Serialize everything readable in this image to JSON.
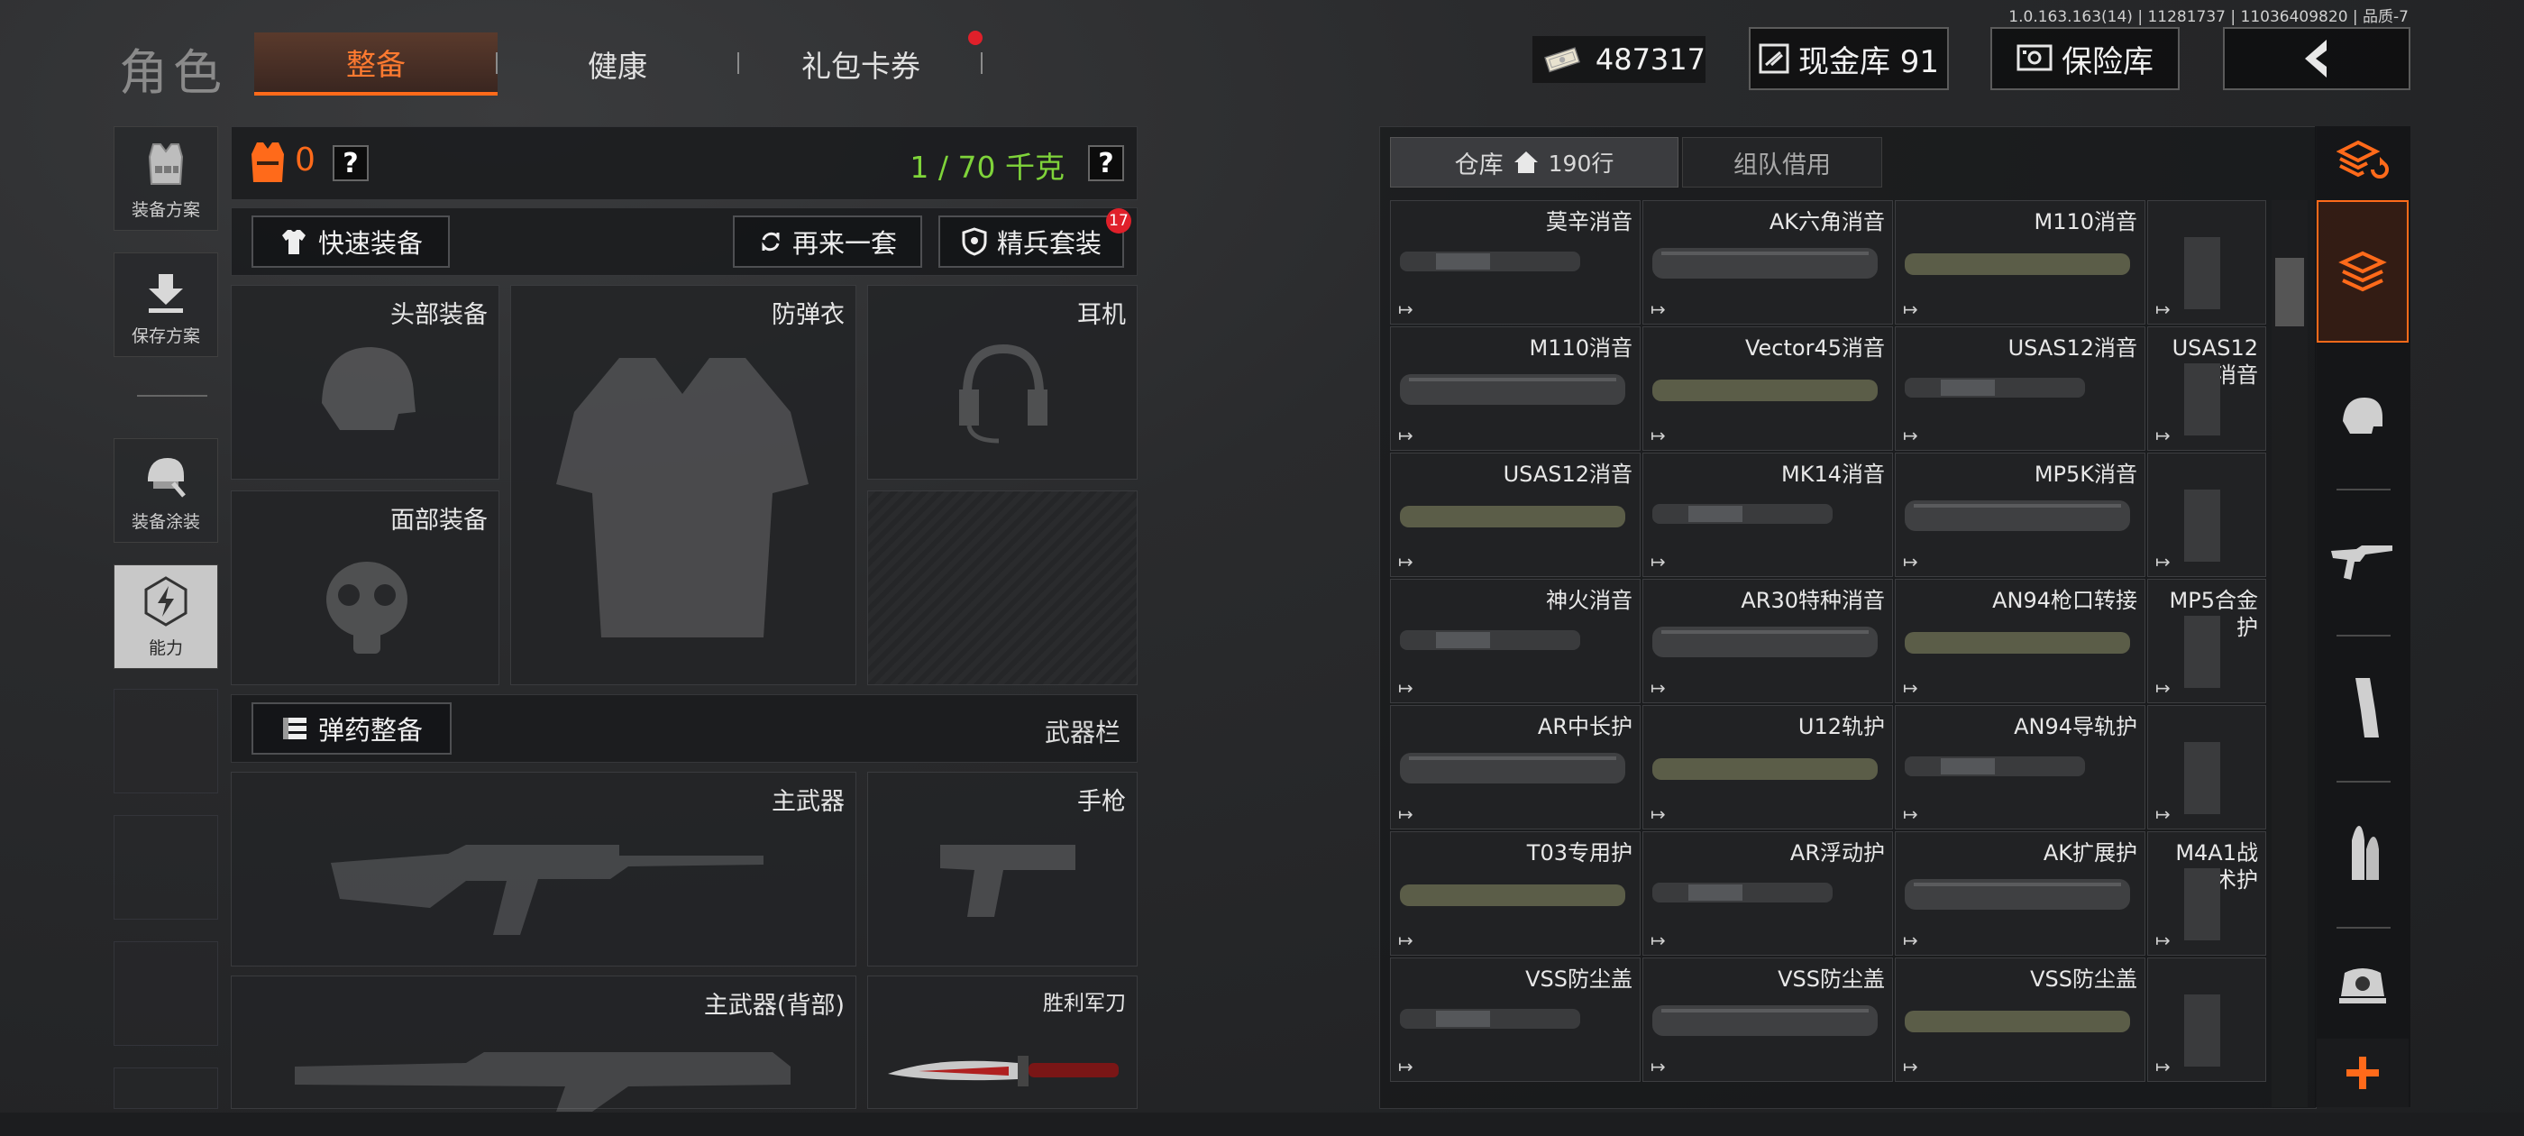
{
  "version": "1.0.163.163(14) | 11281737 | 11036409820 | 品质-7",
  "header": {
    "title": "角色",
    "tabs": [
      {
        "label": "整备",
        "active": true
      },
      {
        "label": "健康",
        "active": false
      },
      {
        "label": "礼包卡券",
        "active": false,
        "badge": true
      }
    ],
    "money": "487317",
    "cash_vault": "现金库 91",
    "safe_vault": "保险库",
    "accent": "#ff6a1a"
  },
  "left_menu": [
    {
      "label": "装备方案",
      "icon": "vest-icon"
    },
    {
      "label": "保存方案",
      "icon": "download-icon"
    },
    {
      "label": "装备涂装",
      "icon": "helmet-paint-icon"
    },
    {
      "label": "能力",
      "icon": "lightning-icon"
    }
  ],
  "equip": {
    "armor_level": "0",
    "weight": "1 / 70 千克",
    "quick_equip": "快速装备",
    "reroll": "再来一套",
    "elite_set": "精兵套装",
    "elite_badge": "17",
    "slots": {
      "head": "头部装备",
      "vest": "防弹衣",
      "ear": "耳机",
      "face": "面部装备",
      "primary": "主武器",
      "pistol": "手枪",
      "primary_back": "主武器(背部)",
      "knife": "胜利军刀"
    },
    "ammo_equip": "弹药整备",
    "weapon_bar": "武器栏"
  },
  "warehouse": {
    "tab_storage": "仓库",
    "rows": "190行",
    "tab_team": "组队借用",
    "items": [
      [
        "莫辛消音",
        "AK六角消音",
        "M110消音",
        ""
      ],
      [
        "M110消音",
        "Vector45消音",
        "USAS12消音",
        "USAS12消音"
      ],
      [
        "USAS12消音",
        "MK14消音",
        "MP5K消音",
        ""
      ],
      [
        "神火消音",
        "AR30特种消音",
        "AN94枪口转接",
        "MP5合金护"
      ],
      [
        "AR中长护",
        "U12轨护",
        "AN94导轨护",
        ""
      ],
      [
        "T03专用护",
        "AR浮动护",
        "AK扩展护",
        "M4A1战术护"
      ],
      [
        "VSS防尘盖",
        "VSS防尘盖",
        "VSS防尘盖",
        ""
      ]
    ]
  }
}
